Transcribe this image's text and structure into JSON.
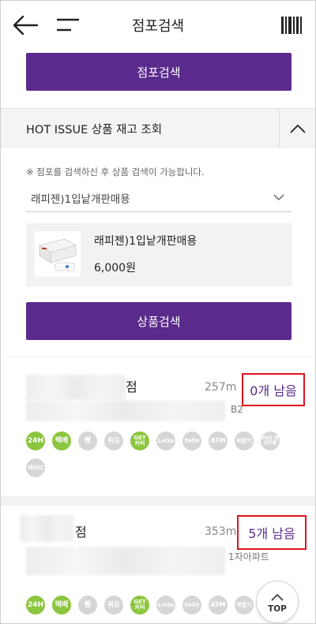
{
  "header": {
    "title": "점포검색"
  },
  "top_search_button": "점포검색",
  "hot_issue": {
    "title": "HOT ISSUE 상품 재고 조회"
  },
  "panel": {
    "notice": "※ 점포를 검색하신 후 상품 검색이 가능합니다.",
    "select_value": "래피젠)1입낱개판매용",
    "product": {
      "name": "래피젠)1입낱개판매용",
      "price": "6,000원"
    },
    "search_button": "상품검색"
  },
  "stores": [
    {
      "suffix": "점",
      "distance": "257m",
      "stock": "0개 남음",
      "floor": "B2",
      "services": [
        "24H",
        "택배",
        "빵",
        "튀김",
        "GET 커피",
        "Lotto",
        "toto",
        "ATM",
        "복합기",
        "POS 현금인출",
        "배터리"
      ]
    },
    {
      "suffix": "점",
      "distance": "353m",
      "stock": "5개 남음",
      "floor": "1자아파트",
      "services": [
        "24H",
        "택배",
        "빵",
        "튀김",
        "GET 커피",
        "Lotto",
        "toto",
        "ATM",
        "복합기"
      ]
    }
  ],
  "top_button": "TOP",
  "colors": {
    "purple": "#5a2a8c",
    "green_badge": "#8cc63f",
    "gray_badge": "#d6d6d6",
    "highlight_red": "#e0141e"
  },
  "icons": [
    "back-arrow-icon",
    "menu-icon",
    "barcode-icon",
    "chevron-up-icon",
    "chevron-down-icon",
    "arrow-up-icon"
  ]
}
